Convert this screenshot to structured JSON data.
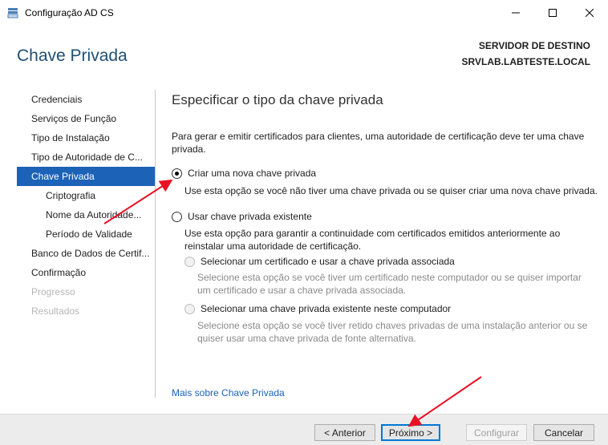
{
  "window": {
    "title": "Configuração AD CS",
    "minimize": "—",
    "maximize": "☐",
    "close": "✕"
  },
  "header": {
    "page_title": "Chave Privada",
    "destination_label": "SERVIDOR DE DESTINO",
    "destination_server": "SRVLAB.LABTESTE.LOCAL"
  },
  "nav": {
    "items": [
      {
        "label": "Credenciais"
      },
      {
        "label": "Serviços de Função"
      },
      {
        "label": "Tipo de Instalação"
      },
      {
        "label": "Tipo de Autoridade de C..."
      },
      {
        "label": "Chave Privada"
      },
      {
        "label": "Criptografia"
      },
      {
        "label": "Nome da Autoridade..."
      },
      {
        "label": "Período de Validade"
      },
      {
        "label": "Banco de Dados de Certif..."
      },
      {
        "label": "Confirmação"
      },
      {
        "label": "Progresso"
      },
      {
        "label": "Resultados"
      }
    ]
  },
  "content": {
    "section_title": "Especificar o tipo da chave privada",
    "intro": "Para gerar e emitir certificados para clientes, uma autoridade de certificação deve ter uma chave privada.",
    "option_new": {
      "label": "Criar uma nova chave privada",
      "desc": "Use esta opção se você não tiver uma chave privada ou se quiser criar uma nova chave privada."
    },
    "option_existing": {
      "label": "Usar chave privada existente",
      "desc": "Use esta opção para garantir a continuidade com certificados emitidos anteriormente ao reinstalar uma autoridade de certificação."
    },
    "sub_cert": {
      "label": "Selecionar um certificado e usar a chave privada associada",
      "desc": "Selecione esta opção se você tiver um certificado neste computador ou se quiser importar um certificado e usar a chave privada associada."
    },
    "sub_key": {
      "label": "Selecionar uma chave privada existente neste computador",
      "desc": "Selecione esta opção se você tiver retido chaves privadas de uma instalação anterior ou se quiser usar uma chave privada de fonte alternativa."
    },
    "more_link": "Mais sobre Chave Privada"
  },
  "footer": {
    "back": "< Anterior",
    "next": "Próximo >",
    "configure": "Configurar",
    "cancel": "Cancelar"
  },
  "colors": {
    "accent": "#1c62b7",
    "arrow": "#e81123"
  }
}
